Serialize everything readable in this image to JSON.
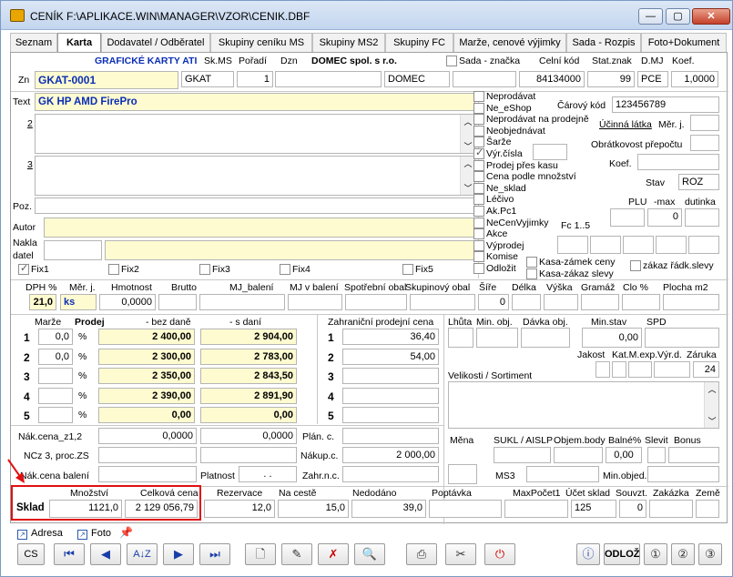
{
  "window": {
    "title": "CENÍK F:\\APLIKACE.WIN\\MANAGER\\VZOR\\CENIK.DBF",
    "minimize": "—",
    "maximize": "▢",
    "close": "✕"
  },
  "tabs": [
    "Seznam",
    "Karta",
    "Dodavatel / Odběratel",
    "Skupiny ceníku MS",
    "Skupiny MS2",
    "Skupiny FC",
    "Marže, cenové výjimky",
    "Sada - Rozpis",
    "Foto+Dokument"
  ],
  "header": {
    "group_name": "GRAFICKÉ KARTY ATI",
    "col_skms": "Sk.MS",
    "col_poradi": "Pořadí",
    "col_dzn": "Dzn",
    "supplier": "DOMEC spol. s r.o.",
    "sada_znacka": "Sada - značka",
    "celni_kod": "Celní kód",
    "stat_znak": "Stat.znak",
    "dmj": "D.MJ",
    "koef": "Koef."
  },
  "zn": {
    "label": "Zn",
    "code": "GKAT-0001",
    "skms": "GKAT",
    "poradi": "1",
    "dzn": "",
    "supplier_code": "DOMEC",
    "celni_kod": "84134000",
    "stat_znak": "99",
    "dmj": "PCE",
    "koef": "1,0000"
  },
  "text": {
    "label": "Text",
    "line1": "GK HP AMD FirePro",
    "label2": "2",
    "label3": "3"
  },
  "left_fields": {
    "poz_label": "Poz.",
    "autor_label": "Autor",
    "nakladatel_label1": "Nakla",
    "nakladatel_label2": "datel"
  },
  "fix": [
    "Fix1",
    "Fix2",
    "Fix3",
    "Fix4",
    "Fix5"
  ],
  "flags": [
    {
      "label": "Neprodávat",
      "checked": false
    },
    {
      "label": "Ne_eShop",
      "checked": false
    },
    {
      "label": "Neprodávat na prodejně",
      "checked": false
    },
    {
      "label": "Neobjednávat",
      "checked": false
    },
    {
      "label": "Šarže",
      "checked": false
    },
    {
      "label": "Výr.čísla",
      "checked": true
    },
    {
      "label": "Prodej přes kasu",
      "checked": false
    },
    {
      "label": "Cena podle množství",
      "checked": false
    },
    {
      "label": "Ne_sklad",
      "checked": false
    },
    {
      "label": "Léčivo",
      "checked": false
    },
    {
      "label": "Ak.Pc1",
      "checked": false
    },
    {
      "label": "NeCenVyjimky",
      "checked": false
    },
    {
      "label": "Akce",
      "checked": false
    },
    {
      "label": "Výprodej",
      "checked": false
    },
    {
      "label": "Komise",
      "checked": false
    },
    {
      "label": "Odložit",
      "checked": false
    }
  ],
  "right_info": {
    "carovy_kod_label": "Čárový kód",
    "carovy_kod": "123456789",
    "ucinna_latka": "Účinná látka",
    "mer_j_label": "Měr. j.",
    "obchodni_prepoctu": "Obrátkovost přepočtu",
    "koef_label": "Koef.",
    "stav_label": "Stav",
    "stav": "ROZ",
    "plu_label": "PLU",
    "max_label": "-max",
    "dutinka_label": "dutinka",
    "max_value": "0",
    "fc_label": "Fc 1..5",
    "kasa_zamek": "Kasa-zámek ceny",
    "kasa_zakaz": "Kasa-zákaz slevy",
    "zakaz_radk": "zákaz řádk.slevy"
  },
  "params": {
    "headers": [
      "DPH %",
      "Měr. j.",
      "Hmotnost",
      "Brutto",
      "MJ_balení",
      "MJ v balení",
      "Spotřební obal",
      "Skupinový obal",
      "Šíře",
      "Délka",
      "Výška",
      "Gramáž",
      "Clo %",
      "Plocha m2"
    ],
    "dph": "21,0",
    "mj": "ks",
    "hmotnost": "0,0000",
    "sire": "0"
  },
  "prices": {
    "marze_label": "Marže",
    "prodej_label": "Prodej",
    "bez_dane_label": "- bez daně",
    "s_dani_label": "- s daní",
    "rows": [
      {
        "n": "1",
        "marze": "0,0",
        "pct": "%",
        "bez": "2 400,00",
        "s": "2 904,00"
      },
      {
        "n": "2",
        "marze": "0,0",
        "pct": "%",
        "bez": "2 300,00",
        "s": "2 783,00"
      },
      {
        "n": "3",
        "marze": "",
        "pct": "%",
        "bez": "2 350,00",
        "s": "2 843,50"
      },
      {
        "n": "4",
        "marze": "",
        "pct": "%",
        "bez": "2 390,00",
        "s": "2 891,90"
      },
      {
        "n": "5",
        "marze": "",
        "pct": "%",
        "bez": "0,00",
        "s": "0,00"
      }
    ],
    "zahranicni_label": "Zahraniční prodejní cena",
    "zahranicni": [
      {
        "n": "1",
        "v": "36,40"
      },
      {
        "n": "2",
        "v": "54,00"
      },
      {
        "n": "3",
        "v": ""
      },
      {
        "n": "4",
        "v": ""
      },
      {
        "n": "5",
        "v": ""
      }
    ]
  },
  "order_info": {
    "lhuta": "Lhůta",
    "min_obj": "Min. obj.",
    "davka_obj": "Dávka obj.",
    "min_stav": "Min.stav",
    "spd": "SPD",
    "min_stav_value": "0,00",
    "jakost": "Jakost",
    "kat_m_exp": "Kat.M.exp.",
    "vyr_d": "Výr.d.",
    "zaruka": "Záruka",
    "zaruka_value": "24",
    "velikosti": "Velikosti / Sortiment"
  },
  "purchase": {
    "nak_cena_label": "Nák.cena_z1,2",
    "nak_cena_1": "0,0000",
    "nak_cena_2": "0,0000",
    "ncz_label": "NCz 3, proc.ZS",
    "nak_baleni_label": "Nák.cena balení",
    "platnost_label": "Platnost",
    "platnost_value": ". .",
    "plan_c": "Plán. c.",
    "nakup_c": "Nákup.c.",
    "nakup_c_value": "2 000,00",
    "zahr_n_c": "Zahr.n.c.",
    "mena": "Měna",
    "sukl": "SUKL / AISLP",
    "objem_body": "Objem.body",
    "balne": "Balné%",
    "slevit": "Slevit",
    "bonus": "Bonus",
    "balne_value": "0,00",
    "ms3": "MS3",
    "min_objed": "Min.objed."
  },
  "stock": {
    "sklad_label": "Sklad",
    "mnozstvi_label": "Množství",
    "celkova_cena_label": "Celková cena",
    "mnozstvi": "1121,0",
    "celkova_cena": "2 129 056,79",
    "rezervace_label": "Rezervace",
    "rezervace": "12,0",
    "na_ceste_label": "Na cestě",
    "na_ceste": "15,0",
    "nedodano_label": "Nedodáno",
    "nedodano": "39,0",
    "poptavka_label": "Poptávka",
    "maxpocet_label": "MaxPočet1",
    "ucet_sklad_label": "Účet sklad",
    "ucet_sklad": "125",
    "souvzt_label": "Souvzt.",
    "souvzt": "0",
    "zakazka_label": "Zakázka",
    "zeme_label": "Země"
  },
  "footer": {
    "adresa": "Adresa",
    "foto": "Foto",
    "cs": "CS",
    "odloz": "ODLOŽ"
  }
}
